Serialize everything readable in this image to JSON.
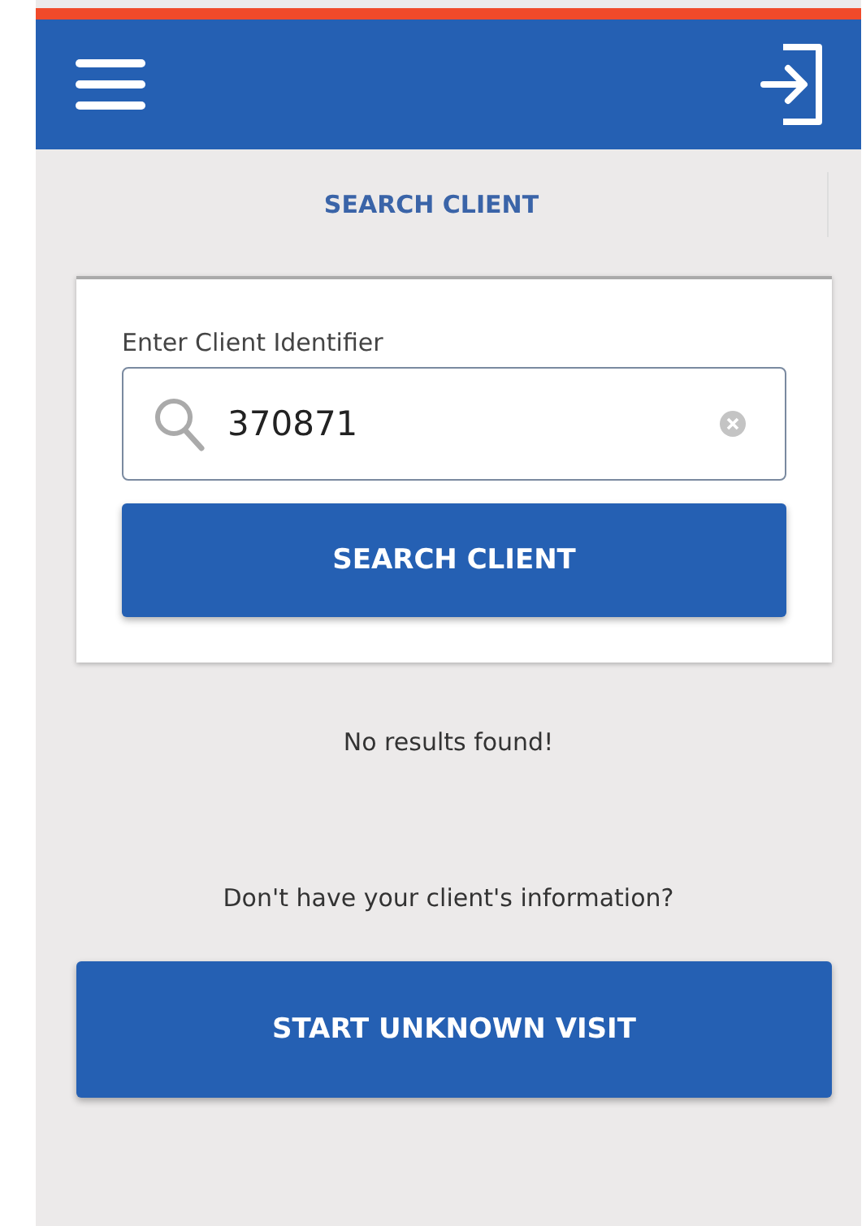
{
  "tabs": [
    {
      "label": "SEARCH CLIENT",
      "selected": true
    }
  ],
  "search_card": {
    "label": "Enter Client Identifier",
    "value": "370871",
    "button": "SEARCH CLIENT"
  },
  "result_message": "No results found!",
  "prompt": "Don't have your client's information?",
  "unknown_visit_button": "START UNKNOWN VISIT"
}
